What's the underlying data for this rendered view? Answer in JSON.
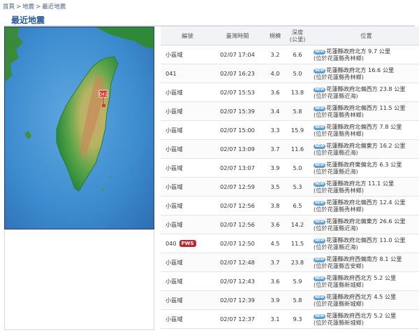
{
  "breadcrumb": {
    "home": "首頁",
    "sep": ">",
    "earthquake": "地震",
    "current": "最近地震"
  },
  "page": {
    "title": "最近地震"
  },
  "map": {
    "epicenter_label": "041"
  },
  "table": {
    "headers": {
      "id": "編號",
      "time": "臺灣時間",
      "magnitude": "規模",
      "depth_line1": "深度",
      "depth_line2": "(公里)",
      "position": "位置"
    },
    "badge_new": "NEW",
    "rows": [
      {
        "id": "小區域",
        "pws": "",
        "time": "02/07 17:04",
        "mag": "3.2",
        "depth": "6.6",
        "loc": "花蓮縣政府北方 9.7 公里",
        "sub": "(位於花蓮縣秀林鄉)"
      },
      {
        "id": "041",
        "pws": "",
        "time": "02/07 16:23",
        "mag": "4.0",
        "depth": "5.0",
        "loc": "花蓮縣政府北方 16.6 公里",
        "sub": "(位於花蓮縣秀林鄉)"
      },
      {
        "id": "小區域",
        "pws": "",
        "time": "02/07 15:53",
        "mag": "3.6",
        "depth": "13.8",
        "loc": "花蓮縣政府北偏西方 23.8 公里",
        "sub": "(位於花蓮縣近海)"
      },
      {
        "id": "小區域",
        "pws": "",
        "time": "02/07 15:39",
        "mag": "3.4",
        "depth": "5.8",
        "loc": "花蓮縣政府北偏西方 11.5 公里",
        "sub": "(位於花蓮縣秀林鄉)"
      },
      {
        "id": "小區域",
        "pws": "",
        "time": "02/07 15:00",
        "mag": "3.3",
        "depth": "15.9",
        "loc": "花蓮縣政府北偏西方 7.8 公里",
        "sub": "(位於花蓮縣秀林鄉)"
      },
      {
        "id": "小區域",
        "pws": "",
        "time": "02/07 13:09",
        "mag": "3.7",
        "depth": "11.6",
        "loc": "花蓮縣政府北偏東方 16.2 公里",
        "sub": "(位於花蓮縣近海)"
      },
      {
        "id": "小區域",
        "pws": "",
        "time": "02/07 13:07",
        "mag": "3.9",
        "depth": "5.0",
        "loc": "花蓮縣政府東偏北方 6.3 公里",
        "sub": "(位於花蓮縣近海)"
      },
      {
        "id": "小區域",
        "pws": "",
        "time": "02/07 12:59",
        "mag": "3.5",
        "depth": "5.3",
        "loc": "花蓮縣政府北方 11.1 公里",
        "sub": "(位於花蓮縣秀林鄉)"
      },
      {
        "id": "小區域",
        "pws": "",
        "time": "02/07 12:56",
        "mag": "3.8",
        "depth": "6.5",
        "loc": "花蓮縣政府北偏西方 12.4 公里",
        "sub": "(位於花蓮縣秀林鄉)"
      },
      {
        "id": "小區域",
        "pws": "",
        "time": "02/07 12:56",
        "mag": "3.6",
        "depth": "14.2",
        "loc": "花蓮縣政府北偏東方 26.6 公里",
        "sub": "(位於花蓮縣近海)"
      },
      {
        "id": "040",
        "pws": "PWS",
        "time": "02/07 12:50",
        "mag": "4.5",
        "depth": "11.5",
        "loc": "花蓮縣政府北偏西方 11.0 公里",
        "sub": "(位於花蓮縣近海)"
      },
      {
        "id": "小區域",
        "pws": "",
        "time": "02/07 12:48",
        "mag": "3.7",
        "depth": "23.8",
        "loc": "花蓮縣政府西偏南方 8.1 公里",
        "sub": "(位於花蓮縣吉安鄉)"
      },
      {
        "id": "小區域",
        "pws": "",
        "time": "02/07 12:43",
        "mag": "3.6",
        "depth": "5.9",
        "loc": "花蓮縣政府西北方 5.2 公里",
        "sub": "(位於花蓮縣新城鄉)"
      },
      {
        "id": "小區域",
        "pws": "",
        "time": "02/07 12:39",
        "mag": "3.9",
        "depth": "5.8",
        "loc": "花蓮縣政府西北方 4.5 公里",
        "sub": "(位於花蓮縣新城鄉)"
      },
      {
        "id": "小區域",
        "pws": "",
        "time": "02/07 12:37",
        "mag": "3.1",
        "depth": "9.3",
        "loc": "花蓮縣政府西北方 5.2 公里",
        "sub": "(位於花蓮縣新城鄉)"
      }
    ]
  },
  "colors": {
    "title_blue": "#2a5a9e",
    "link_blue": "#4a5f8c",
    "pws_red": "#c0262d",
    "new_badge_blue": "#5b9fd6",
    "sea": "#3f8fd1",
    "land_green": "#2f8a3c"
  }
}
